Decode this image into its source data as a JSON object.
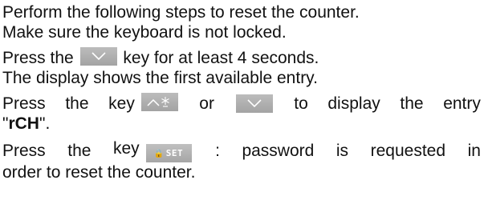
{
  "paragraph_1": "Perform the following steps to reset the counter.",
  "paragraph_2": "Make sure the keyboard is not locked.",
  "step_1": {
    "before": "Press the",
    "after": "key for at least 4 seconds."
  },
  "paragraph_3": "The display shows the first available entry.",
  "step_2": {
    "w1": "Press",
    "w2": "the",
    "w3": "key",
    "w4": "or",
    "w5": "to",
    "w6": "display",
    "w7": "the",
    "w8": "entry",
    "quote_open": "\"",
    "entry": "rCH",
    "quote_close": "\"."
  },
  "step_3": {
    "w1": "Press",
    "w2": "the",
    "w3": "key",
    "w4": ":",
    "w5": "password",
    "w6": "is",
    "w7": "requested",
    "w8": "in",
    "line2": "order to reset the counter."
  },
  "keys": {
    "down": {
      "icon": "down-arrow-icon"
    },
    "up_defrost": {
      "icon": "up-arrow-defrost-icon"
    },
    "set": {
      "icon": "lock-icon",
      "label": "SET"
    }
  },
  "colors": {
    "key_face": "#b0b0b0",
    "key_symbol": "#ffffff"
  }
}
